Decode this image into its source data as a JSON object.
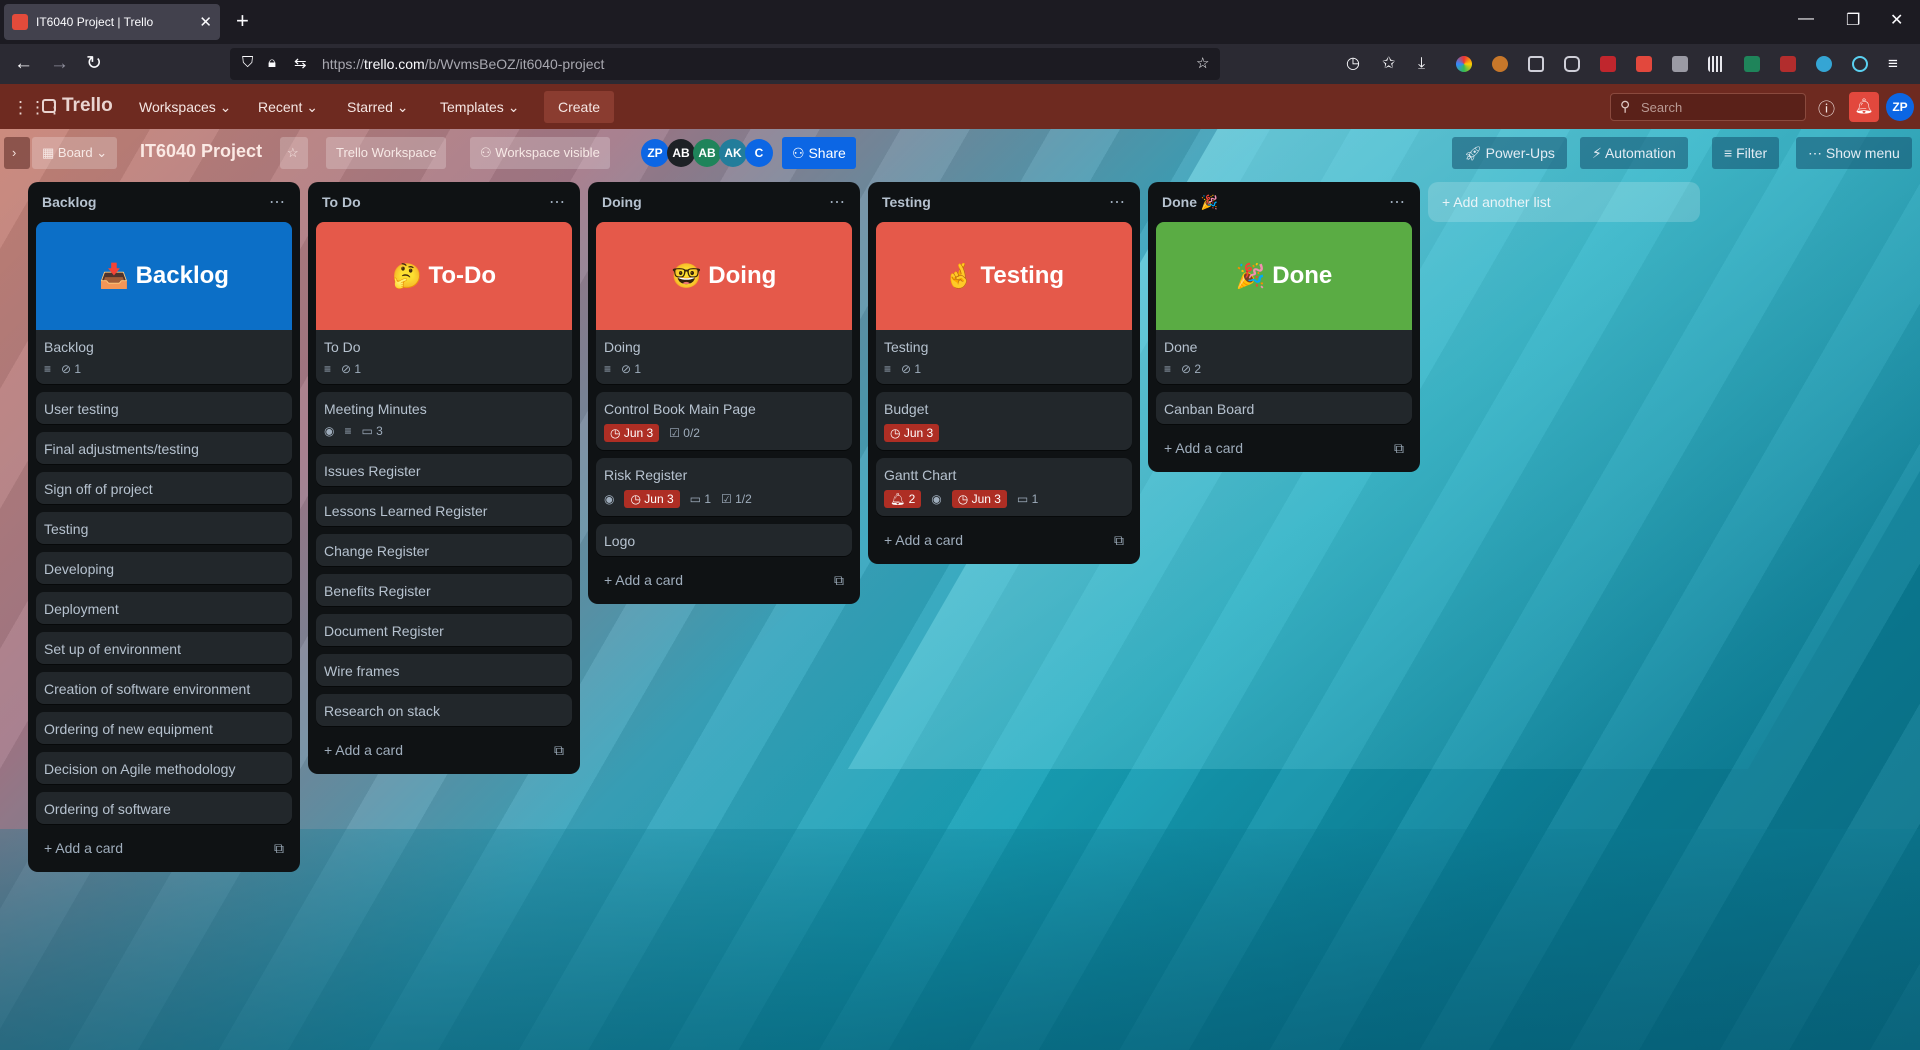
{
  "browser": {
    "tab_title": "IT6040 Project | Trello",
    "new_tab": "+",
    "url_prefix": "https://",
    "url_host": "trello.com",
    "url_path": "/b/WvmsBeOZ/it6040-project"
  },
  "header": {
    "logo": "Trello",
    "menus": [
      "Workspaces",
      "Recent",
      "Starred",
      "Templates"
    ],
    "create": "Create",
    "search_placeholder": "Search",
    "user_initials": "ZP"
  },
  "board_bar": {
    "view": "Board",
    "title": "IT6040 Project",
    "workspace": "Trello Workspace",
    "visibility": "Workspace visible",
    "members": [
      {
        "initials": "ZP",
        "color": "#0c66e4"
      },
      {
        "initials": "AB",
        "color": "#1d2125"
      },
      {
        "initials": "AB",
        "color": "#1f845a"
      },
      {
        "initials": "AK",
        "color": "#227d9b"
      },
      {
        "initials": "C",
        "color": "#0c66e4"
      }
    ],
    "share": "Share",
    "power_ups": "Power-Ups",
    "automation": "Automation",
    "filter": "Filter",
    "show_menu": "Show menu"
  },
  "lists": [
    {
      "title": "Backlog",
      "cover": {
        "text": "Backlog",
        "emoji": "📥",
        "color": "#0c6fc7"
      },
      "cards": [
        {
          "title": "Backlog",
          "badges": {
            "desc": true,
            "attach": "1"
          }
        },
        {
          "title": "User testing"
        },
        {
          "title": "Final adjustments/testing"
        },
        {
          "title": "Sign off of project"
        },
        {
          "title": "Testing"
        },
        {
          "title": "Developing"
        },
        {
          "title": "Deployment"
        },
        {
          "title": "Set up of environment"
        },
        {
          "title": "Creation of software environment"
        },
        {
          "title": "Ordering of new equipment"
        },
        {
          "title": "Decision on Agile methodology"
        },
        {
          "title": "Ordering of software"
        }
      ],
      "add": "Add a card"
    },
    {
      "title": "To Do",
      "cover": {
        "text": "To-Do",
        "emoji": "🤔",
        "color": "#e5594a"
      },
      "cards": [
        {
          "title": "To Do",
          "badges": {
            "desc": true,
            "attach": "1"
          }
        },
        {
          "title": "Meeting Minutes",
          "badges": {
            "watch": true,
            "desc": true,
            "comments": "3"
          }
        },
        {
          "title": "Issues Register"
        },
        {
          "title": "Lessons Learned Register"
        },
        {
          "title": "Change Register"
        },
        {
          "title": "Benefits Register"
        },
        {
          "title": "Document Register"
        },
        {
          "title": "Wire frames"
        },
        {
          "title": "Research on stack"
        }
      ],
      "add": "Add a card"
    },
    {
      "title": "Doing",
      "cover": {
        "text": "Doing",
        "emoji": "🤓",
        "color": "#e5594a"
      },
      "cards": [
        {
          "title": "Doing",
          "badges": {
            "desc": true,
            "attach": "1"
          }
        },
        {
          "title": "Control Book Main Page",
          "badges": {
            "due": "Jun 3",
            "checklist": "0/2"
          }
        },
        {
          "title": "Risk Register",
          "badges": {
            "watch": true,
            "due": "Jun 3",
            "comments": "1",
            "checklist": "1/2"
          }
        },
        {
          "title": "Logo"
        }
      ],
      "add": "Add a card"
    },
    {
      "title": "Testing",
      "cover": {
        "text": "Testing",
        "emoji": "🤞",
        "color": "#e5594a"
      },
      "cards": [
        {
          "title": "Testing",
          "badges": {
            "desc": true,
            "attach": "1"
          }
        },
        {
          "title": "Budget",
          "badges": {
            "due": "Jun 3"
          }
        },
        {
          "title": "Gantt Chart",
          "badges": {
            "notif": "2",
            "watch": true,
            "due": "Jun 3",
            "comments": "1"
          }
        }
      ],
      "add": "Add a card"
    },
    {
      "title": "Done 🎉",
      "cover": {
        "text": "Done",
        "emoji": "🎉",
        "color": "#5aac44"
      },
      "cards": [
        {
          "title": "Done",
          "badges": {
            "desc": true,
            "attach": "2"
          }
        },
        {
          "title": "Canban Board"
        }
      ],
      "add": "Add a card"
    }
  ],
  "add_list": "Add another list"
}
